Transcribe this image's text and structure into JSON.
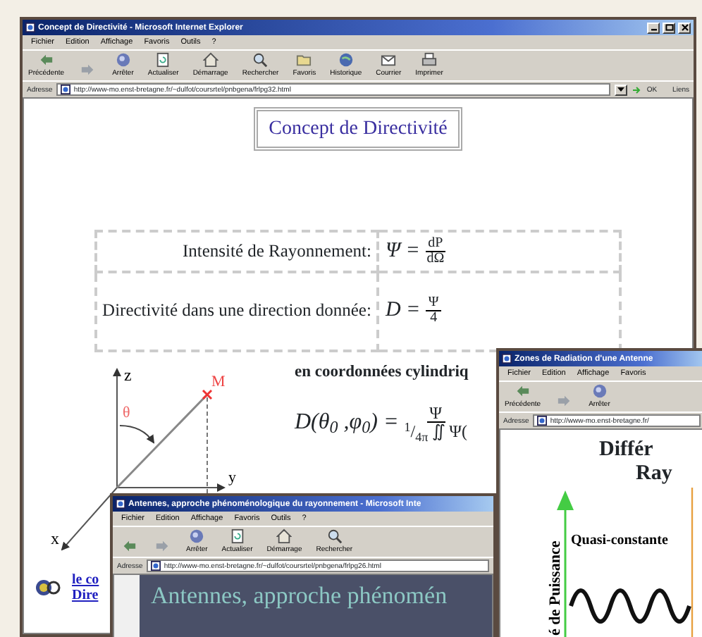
{
  "main_window": {
    "title": "Concept de Directivité - Microsoft Internet Explorer",
    "menu": [
      "Fichier",
      "Edition",
      "Affichage",
      "Favoris",
      "Outils",
      "?"
    ],
    "toolbar": [
      {
        "kind": "back",
        "label": "Précédente"
      },
      {
        "kind": "forward"
      },
      {
        "kind": "stop",
        "label": "Arrêter"
      },
      {
        "kind": "refresh",
        "label": "Actualiser"
      },
      {
        "kind": "home",
        "label": "Démarrage"
      },
      {
        "kind": "search",
        "label": "Rechercher"
      },
      {
        "kind": "favorites",
        "label": "Favoris"
      },
      {
        "kind": "history",
        "label": "Historique"
      },
      {
        "kind": "mail",
        "label": "Courrier"
      },
      {
        "kind": "print",
        "label": "Imprimer"
      }
    ],
    "address": {
      "label": "Adresse",
      "url": "http://www-mo.enst-bretagne.fr/~dulfot/coursrtel/pnbgena/frlpg32.html",
      "go": "OK",
      "links": "Liens"
    },
    "page": {
      "heading": "Concept de Directivité",
      "table_rows": [
        {
          "label": "Intensité de Rayonnement:",
          "lhs": "Ψ =",
          "numerator": "dP",
          "denominator": "dΩ"
        },
        {
          "label": "Directivité dans une direction donnée:",
          "lhs": "D =",
          "numerator": "Ψ",
          "denominator": "4"
        }
      ],
      "diagram_labels": {
        "z": "z",
        "y": "y",
        "x": "x",
        "point": "M",
        "angle": "θ"
      },
      "caption": "en coordonnées cylindriq",
      "formula": {
        "lhs": "D(θ$_{0}$ ,φ$_{0}$) =",
        "numerator": "Ψ",
        "denominator": "$^{1}$/$_{4π}$ ∬ Ψ("
      },
      "links": [
        "le co",
        "Dire"
      ]
    }
  },
  "radiation_window": {
    "title": "Zones de Radiation d'une Antenne",
    "menu": [
      "Fichier",
      "Edition",
      "Affichage",
      "Favoris"
    ],
    "toolbar": [
      {
        "kind": "back",
        "label": "Précédente"
      },
      {
        "kind": "forward"
      },
      {
        "kind": "stop",
        "label": "Arrêter"
      }
    ],
    "address": {
      "label": "Adresse",
      "url": "http://www-mo.enst-bretagne.fr/"
    },
    "heading_lines": [
      "Différ",
      "Ray"
    ],
    "axis_label": "é de Puissance",
    "curve_label": "Quasi-constante"
  },
  "approach_window": {
    "title": "Antennes, approche phénoménologique du rayonnement - Microsoft Inte",
    "menu": [
      "Fichier",
      "Edition",
      "Affichage",
      "Favoris",
      "Outils",
      "?"
    ],
    "toolbar": [
      {
        "kind": "back"
      },
      {
        "kind": "forward"
      },
      {
        "kind": "stop",
        "label": "Arrêter"
      },
      {
        "kind": "refresh",
        "label": "Actualiser"
      },
      {
        "kind": "home",
        "label": "Démarrage"
      },
      {
        "kind": "search",
        "label": "Rechercher"
      }
    ],
    "address": {
      "label": "Adresse",
      "url": "http://www-mo.enst-bretagne.fr/~dulfot/coursrtel/pnbgena/frlpg26.html"
    },
    "banner": "Antennes, approche phénomén"
  }
}
